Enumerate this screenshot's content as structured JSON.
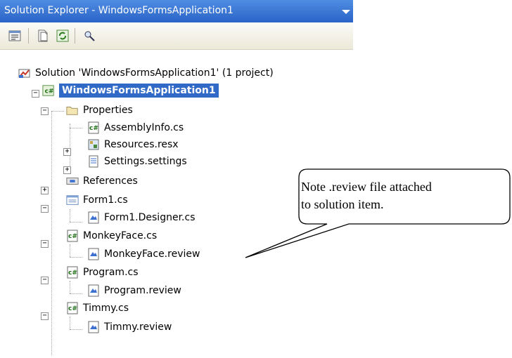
{
  "window": {
    "title": "Solution Explorer - WindowsFormsApplication1"
  },
  "toolbar": {
    "buttons": [
      "properties-icon",
      "show-all-files-icon",
      "refresh-icon",
      "view-class-diagram-icon"
    ]
  },
  "tree": {
    "solution": "Solution 'WindowsFormsApplication1' (1 project)",
    "project": "WindowsFormsApplication1",
    "items": [
      {
        "label": "Properties",
        "icon": "folder-icon"
      },
      {
        "label": "AssemblyInfo.cs",
        "icon": "csharp-file-icon"
      },
      {
        "label": "Resources.resx",
        "icon": "resx-icon"
      },
      {
        "label": "Settings.settings",
        "icon": "settings-icon"
      },
      {
        "label": "References",
        "icon": "references-icon"
      },
      {
        "label": "Form1.cs",
        "icon": "form-icon"
      },
      {
        "label": "Form1.Designer.cs",
        "icon": "review-file-icon"
      },
      {
        "label": "MonkeyFace.cs",
        "icon": "csharp-file-icon"
      },
      {
        "label": "MonkeyFace.review",
        "icon": "review-file-icon"
      },
      {
        "label": "Program.cs",
        "icon": "csharp-file-icon"
      },
      {
        "label": "Program.review",
        "icon": "review-file-icon"
      },
      {
        "label": "Timmy.cs",
        "icon": "csharp-file-icon"
      },
      {
        "label": "Timmy.review",
        "icon": "review-file-icon"
      }
    ]
  },
  "callout": {
    "line1": "Note .review file attached",
    "line2": "to solution item."
  }
}
